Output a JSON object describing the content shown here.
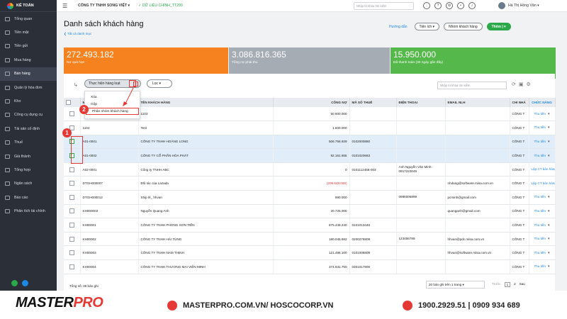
{
  "app": {
    "logo_text": "KẾ TOÁN"
  },
  "sidebar": {
    "items": [
      {
        "label": "Tổng quan"
      },
      {
        "label": "Tiền mặt"
      },
      {
        "label": "Tiền gửi"
      },
      {
        "label": "Mua hàng"
      },
      {
        "label": "Bán hàng"
      },
      {
        "label": "Quản lý hóa đơn"
      },
      {
        "label": "Kho"
      },
      {
        "label": "Công cụ dụng cụ"
      },
      {
        "label": "Tài sản cố định"
      },
      {
        "label": "Thuế"
      },
      {
        "label": "Giá thành"
      },
      {
        "label": "Tổng hợp"
      },
      {
        "label": "Ngân sách"
      },
      {
        "label": "Báo cáo"
      },
      {
        "label": "Phân tích tài chính"
      }
    ],
    "active_index": 4
  },
  "topbar": {
    "company": "CÔNG TY TNHH SONG VIỆT ▾",
    "sync": "✓ DỮ LIỆU CHÍNH_TT200",
    "search_placeholder": "Nhập từ khóa tìm kiếm",
    "user": "Hà Thị Hồng Vân ▾"
  },
  "page": {
    "title": "Danh sách khách hàng",
    "back": "❮ Tất cả danh mục",
    "guide": "Hướng dẫn",
    "utility_btn": "Tiện ích ▾",
    "group_btn": "Nhóm khách hàng",
    "add_btn": "Thêm  |  ▾"
  },
  "cards": [
    {
      "value": "272.493.182",
      "label": "Nợ quá hạn",
      "color": "#f5821f"
    },
    {
      "value": "3.086.816.365",
      "label": "Tổng nợ phải thu",
      "color": "#a5acb4"
    },
    {
      "value": "15.950.000",
      "label": "Đã thanh toán (30 ngày gần đây)",
      "color": "#55b84a"
    }
  ],
  "toolbar": {
    "batch_label": "Thực hiện hàng loạt",
    "filter_label": "Lọc ▾",
    "search_placeholder": "Nhập từ khóa tìm kiếm"
  },
  "dropdown": {
    "items": [
      "Xóa",
      "Gộp",
      "Phân nhóm khách hàng"
    ]
  },
  "table": {
    "headers": [
      "",
      "MÃ KHÁCH HÀNG",
      "TÊN KHÁCH HÀNG",
      "CÔNG NỢ",
      "MÃ SỐ THUẾ",
      "ĐIỆN THOẠI",
      "EMAIL NLH",
      "CHI NHÁ",
      "CHỨC NĂNG"
    ],
    "rows": [
      {
        "code": "",
        "name": "1103",
        "debt": "50.600.000",
        "tax": "",
        "phone": "",
        "email": "",
        "branch": "CÔNG T",
        "action": "Thu tiền",
        "checked": false
      },
      {
        "code": "1104",
        "name": "Test",
        "debt": "1.500.000",
        "tax": "",
        "phone": "",
        "email": "",
        "branch": "CÔNG T",
        "action": "Thu tiền",
        "checked": false
      },
      {
        "code": "A01-0001",
        "name": "CÔNG TY TNHH HOÀNG LONG",
        "debt": "506.756.929",
        "tax": "0102000880",
        "phone": "",
        "email": "",
        "branch": "CÔNG T",
        "action": "Thu tiền",
        "checked": true
      },
      {
        "code": "A01-0002",
        "name": "CÔNG TY CỔ PHẦN HÒA PHÁT",
        "debt": "92.161.655",
        "tax": "0101020683",
        "phone": "",
        "email": "",
        "branch": "CÔNG T",
        "action": "Thu tiền",
        "checked": true
      },
      {
        "code": "A02-0001",
        "name": "Công ty TNHH ABC",
        "debt": "0",
        "tax": "0101112456-003",
        "phone": "Anh Nguyễn Văn Minh: 0917223045",
        "email": "",
        "branch": "CÔNG T",
        "action": "Lập CT bán hàng",
        "checked": false
      },
      {
        "code": "DTGH000007",
        "name": "Đối tác của Lazada",
        "debt": "(209.648.000)",
        "tax": "",
        "phone": "",
        "email": "nhdang@software.misa.com.vn",
        "branch": "CÔNG T",
        "action": "Lập CT bán hàng",
        "checked": false,
        "negative": true
      },
      {
        "code": "DTGH000012",
        "name": "Ship lẻ_ hhvan",
        "debt": "980.000",
        "tax": "",
        "phone": "0986006899",
        "email": "pcminh@gmail.com",
        "branch": "CÔNG T",
        "action": "Thu tiền",
        "checked": false
      },
      {
        "code": "KH000003",
        "name": "Nguyễn Quang Anh",
        "debt": "20.725.000",
        "tax": "",
        "phone": "",
        "email": "quanganh@gmail.com",
        "branch": "CÔNG T",
        "action": "Thu tiền",
        "checked": false
      },
      {
        "code": "KH00001",
        "name": "CÔNG TY TNHH PHONG SƠN TIẾN",
        "debt": "875.448.240",
        "tax": "0101013446",
        "phone": "",
        "email": "",
        "branch": "CÔNG T",
        "action": "Thu tiền",
        "checked": false
      },
      {
        "code": "KH00002",
        "name": "CÔNG TY TNHH HẢI TÙNG",
        "debt": "180.045.682",
        "tax": "0200276809",
        "phone": "123456789",
        "email": "hhvan@pdc.misa.com.vn",
        "branch": "CÔNG T",
        "action": "Thu tiền",
        "checked": false
      },
      {
        "code": "KH00003",
        "name": "CÔNG TY TNHH NAM THỊNH",
        "debt": "121.496.100",
        "tax": "0101008809",
        "phone": "",
        "email": "hhvan@software.misa.com.vn",
        "branch": "CÔNG T",
        "action": "Thu tiền",
        "checked": false
      },
      {
        "code": "KH00004",
        "name": "CÔNG TY TNHH THƯƠNG MẠI VIỄN MINH",
        "debt": "374.931.750",
        "tax": "0301017800",
        "phone": "",
        "email": "",
        "branch": "CÔNG T",
        "action": "Thu tiền",
        "checked": false
      }
    ]
  },
  "footer": {
    "total": "Tổng số: 36 bản ghi",
    "page_size": "20 bản ghi trên 1 trang ▾",
    "pages": [
      "Trước",
      "1",
      "2",
      "Sau"
    ]
  },
  "annotations": {
    "badge1": "1",
    "badge2": "2"
  },
  "banner": {
    "brand_a": "MASTER",
    "brand_b": "PRO",
    "website": "MASTERPRO.COM.VN/ HOSCOCORP.VN",
    "phones": "1900.2929.51 | 0909 934 689"
  },
  "colors": {
    "accent": "#1e88e5",
    "primary_green": "#2aa84a",
    "annotation_red": "#e53935"
  }
}
